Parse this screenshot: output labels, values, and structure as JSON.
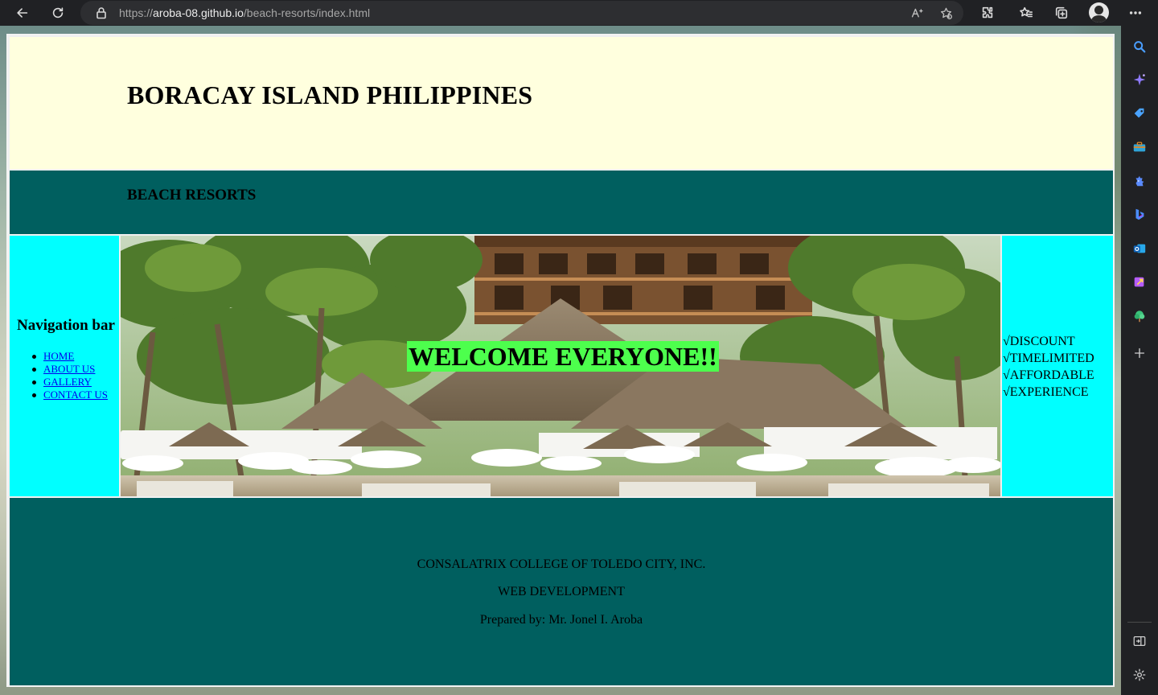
{
  "browser": {
    "url_scheme": "https://",
    "url_host": "aroba-08.github.io",
    "url_path": "/beach-resorts/index.html",
    "toolbar_icons": [
      "back-icon",
      "refresh-icon",
      "lock-icon",
      "read-aloud-icon",
      "add-favorite-icon",
      "extensions-icon",
      "favorites-icon",
      "collections-icon",
      "profile-avatar",
      "more-icon"
    ]
  },
  "edge_sidebar": {
    "items": [
      "search-icon",
      "copilot-icon",
      "shopping-icon",
      "tools-icon",
      "games-icon",
      "bing-icon",
      "outlook-icon",
      "drop-icon",
      "tree-icon",
      "add-icon"
    ],
    "bottom": [
      "split-screen-icon",
      "settings-icon"
    ]
  },
  "page": {
    "title": "BORACAY ISLAND PHILIPPINES",
    "subtitle": "BEACH RESORTS",
    "nav": {
      "heading": "Navigation bar",
      "links": [
        "HOME",
        "ABOUT US",
        "GALLERY",
        "CONTACT US"
      ]
    },
    "hero": {
      "welcome": "WELCOME EVERYONE!!"
    },
    "features": [
      "√DISCOUNT",
      "√TIMELIMITED",
      "√AFFORDABLE",
      "√EXPERIENCE"
    ],
    "footer": {
      "line1": "CONSALATRIX COLLEGE OF TOLEDO CITY, INC.",
      "line2": "WEB DEVELOPMENT",
      "line3": "Prepared by: Mr. Jonel I. Aroba"
    }
  },
  "colors": {
    "header_bg": "#ffffde",
    "teal": "#005f5f",
    "cyan": "#00ffff",
    "welcome_bg": "#4dff4d",
    "link": "#0000ee"
  }
}
